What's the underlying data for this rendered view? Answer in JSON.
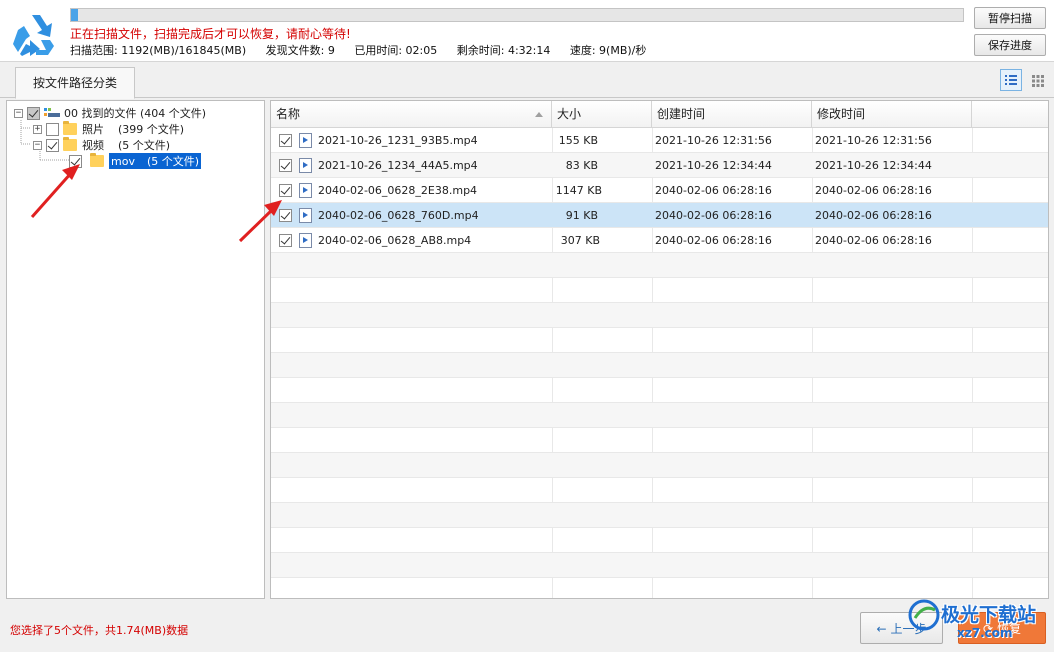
{
  "header": {
    "status_message": "正在扫描文件，扫描完成后才可以恢复，请耐心等待!",
    "scan_range": "扫描范围: 1192(MB)/161845(MB)",
    "files_found": "发现文件数: 9",
    "elapsed": "已用时间: 02:05",
    "remaining": "剩余时间: 4:32:14",
    "speed": "速度: 9(MB)/秒",
    "progress_fraction": 0.0074,
    "pause_label": "暂停扫描",
    "save_label": "保存进度"
  },
  "tabs": {
    "active_label": "按文件路径分类"
  },
  "tree": {
    "root": {
      "label": "00 找到的文件 (404 个文件)"
    },
    "photos": {
      "label": "照片",
      "count": "(399 个文件)"
    },
    "video": {
      "label": "视频",
      "count": "(5 个文件)"
    },
    "mov": {
      "label": "mov",
      "count": "(5 个文件)"
    }
  },
  "list": {
    "columns": [
      "名称",
      "大小",
      "创建时间",
      "修改时间"
    ],
    "rows": [
      {
        "name": "2021-10-26_1231_93B5.mp4",
        "size": "155 KB",
        "created": "2021-10-26  12:31:56",
        "modified": "2021-10-26  12:31:56"
      },
      {
        "name": "2021-10-26_1234_44A5.mp4",
        "size": "83 KB",
        "created": "2021-10-26  12:34:44",
        "modified": "2021-10-26  12:34:44"
      },
      {
        "name": "2040-02-06_0628_2E38.mp4",
        "size": "1147 KB",
        "created": "2040-02-06  06:28:16",
        "modified": "2040-02-06  06:28:16"
      },
      {
        "name": "2040-02-06_0628_760D.mp4",
        "size": "91 KB",
        "created": "2040-02-06  06:28:16",
        "modified": "2040-02-06  06:28:16"
      },
      {
        "name": "2040-02-06_0628_AB8.mp4",
        "size": "307 KB",
        "created": "2040-02-06  06:28:16",
        "modified": "2040-02-06  06:28:16"
      }
    ]
  },
  "footer": {
    "selection_summary": "您选择了5个文件，共1.74(MB)数据",
    "prev_label": "上一步",
    "recover_label": "恢复"
  },
  "watermark": {
    "text": "极光下载站",
    "sub": "xz7.com"
  },
  "colors": {
    "status_red": "#d40000",
    "selection_blue": "#cce4f7",
    "recover_orange": "#f07838",
    "logo_blue": "#2f8fe0"
  }
}
